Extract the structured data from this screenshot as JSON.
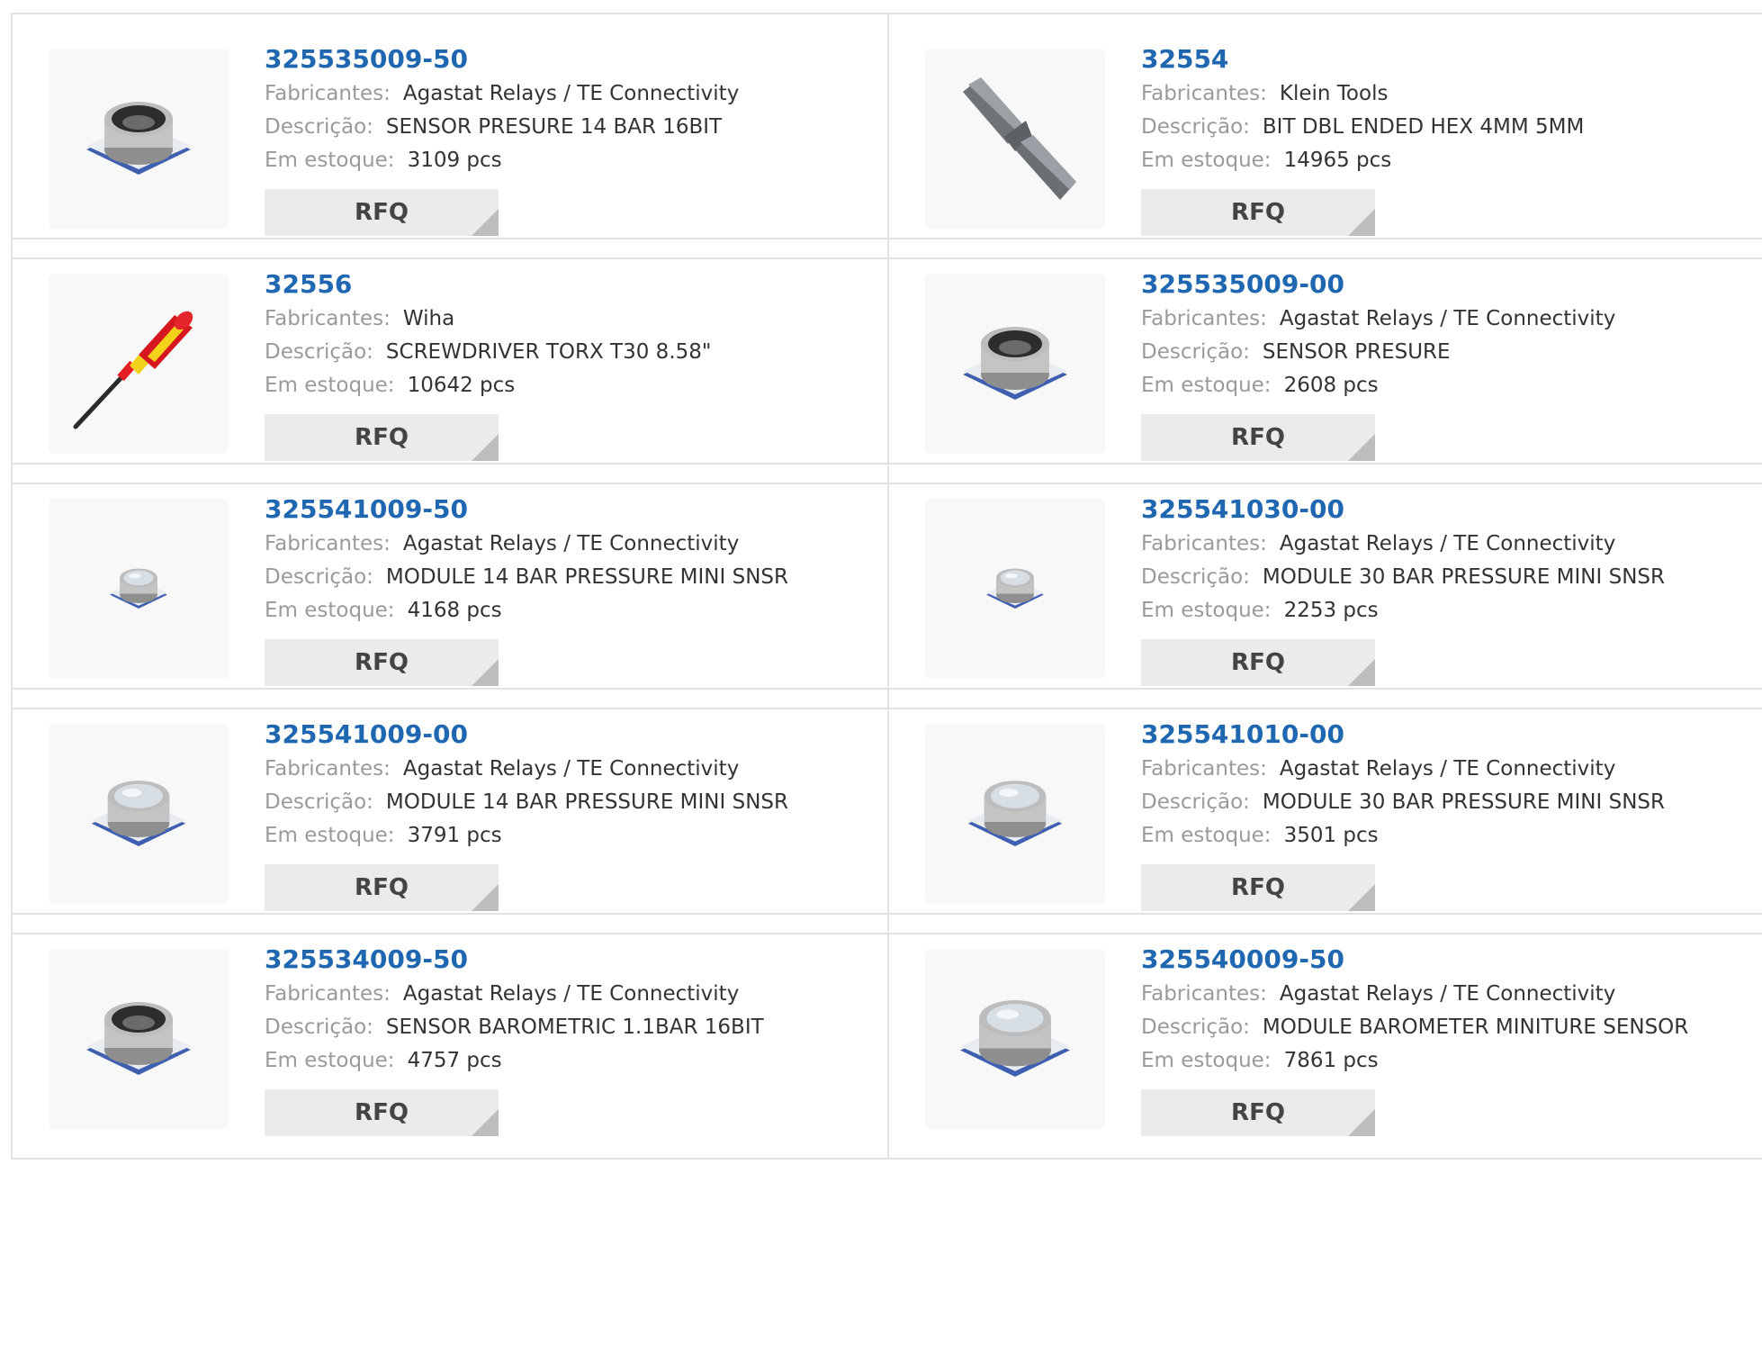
{
  "labels": {
    "manufacturer": "Fabricantes:",
    "description": "Descrição:",
    "stock": "Em estoque:",
    "rfq": "RFQ"
  },
  "colors": {
    "part_number": "#1f67b1",
    "label": "#9a9a9a",
    "button_bg": "#ebebeb"
  },
  "products": [
    {
      "part": "325535009-50",
      "manufacturer": "Agastat Relays / TE Connectivity",
      "description": "SENSOR PRESURE 14 BAR 16BIT",
      "stock": "3109 pcs",
      "icon": "pressure-sensor-icon"
    },
    {
      "part": "32554",
      "manufacturer": "Klein Tools",
      "description": "BIT DBL ENDED HEX 4MM 5MM",
      "stock": "14965 pcs",
      "icon": "hex-bit-icon"
    },
    {
      "part": "32556",
      "manufacturer": "Wiha",
      "description": "SCREWDRIVER TORX T30 8.58\"",
      "stock": "10642 pcs",
      "icon": "screwdriver-icon"
    },
    {
      "part": "325535009-00",
      "manufacturer": "Agastat Relays / TE Connectivity",
      "description": "SENSOR PRESURE",
      "stock": "2608 pcs",
      "icon": "pressure-sensor-icon"
    },
    {
      "part": "325541009-50",
      "manufacturer": "Agastat Relays / TE Connectivity",
      "description": "MODULE 14 BAR PRESSURE MINI SNSR",
      "stock": "4168 pcs",
      "icon": "mini-sensor-icon"
    },
    {
      "part": "325541030-00",
      "manufacturer": "Agastat Relays / TE Connectivity",
      "description": "MODULE 30 BAR PRESSURE MINI SNSR",
      "stock": "2253 pcs",
      "icon": "mini-sensor-icon"
    },
    {
      "part": "325541009-00",
      "manufacturer": "Agastat Relays / TE Connectivity",
      "description": "MODULE 14 BAR PRESSURE MINI SNSR",
      "stock": "3791 pcs",
      "icon": "pressure-module-icon"
    },
    {
      "part": "325541010-00",
      "manufacturer": "Agastat Relays / TE Connectivity",
      "description": "MODULE 30 BAR PRESSURE MINI SNSR",
      "stock": "3501 pcs",
      "icon": "pressure-module-icon"
    },
    {
      "part": "325534009-50",
      "manufacturer": "Agastat Relays / TE Connectivity",
      "description": "SENSOR BAROMETRIC 1.1BAR 16BIT",
      "stock": "4757 pcs",
      "icon": "pressure-sensor-icon"
    },
    {
      "part": "325540009-50",
      "manufacturer": "Agastat Relays / TE Connectivity",
      "description": "MODULE BAROMETER MINITURE SENSOR",
      "stock": "7861 pcs",
      "icon": "barometer-module-icon"
    }
  ]
}
